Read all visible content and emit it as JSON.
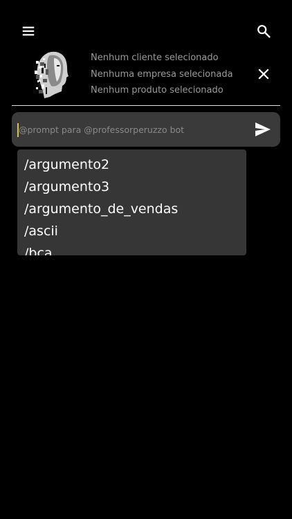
{
  "header": {
    "menu_icon": "menu-icon",
    "search_icon": "search-icon"
  },
  "context": {
    "client": "Nenhum cliente selecionado",
    "company": "Nenhuma empresa selecionada",
    "product": "Nenhum produto selecionado",
    "clear_icon": "close-icon"
  },
  "prompt": {
    "placeholder": "@prompt para @professorperuzzo bot",
    "value": "",
    "send_icon": "send-icon"
  },
  "suggestions": [
    "/argumento2",
    "/argumento3",
    "/argumento_de_vendas",
    "/ascii",
    "/bca"
  ],
  "colors": {
    "background": "#000000",
    "surface": "#3a3a3a",
    "dropdown": "#363636",
    "muted_text": "#9a9a9a",
    "caret": "#d8c24a"
  }
}
